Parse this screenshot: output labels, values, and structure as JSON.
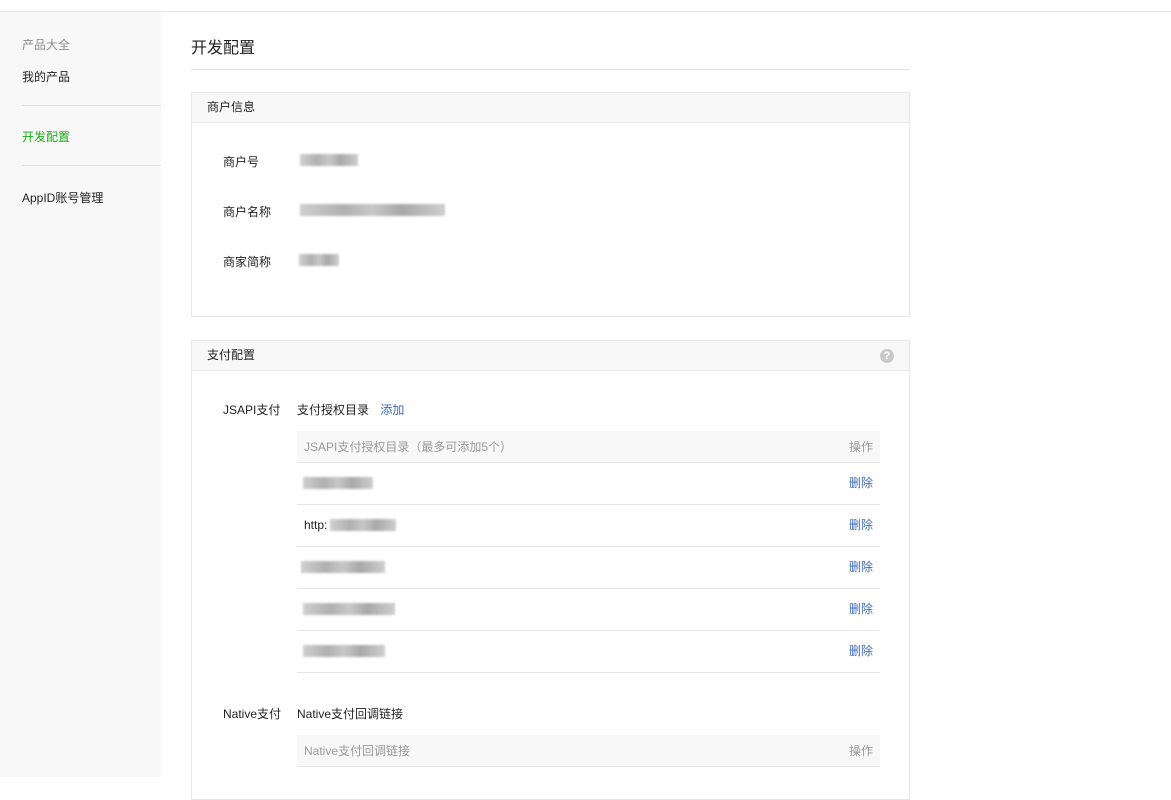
{
  "sidebar": {
    "section_title": "产品大全",
    "items": [
      {
        "label": "我的产品"
      },
      {
        "label": "开发配置"
      },
      {
        "label": "AppID账号管理"
      }
    ]
  },
  "page": {
    "title": "开发配置"
  },
  "merchant_panel": {
    "title": "商户信息",
    "fields": [
      {
        "label": "商户号"
      },
      {
        "label": "商户名称"
      },
      {
        "label": "商家简称"
      }
    ]
  },
  "pay_panel": {
    "title": "支付配置",
    "help_icon": "?",
    "jsapi": {
      "label": "JSAPI支付",
      "sub_label": "支付授权目录",
      "add_label": "添加",
      "table_header": "JSAPI支付授权目录（最多可添加5个）",
      "op_header": "操作",
      "rows": [
        {
          "prefix": "",
          "delete": "删除"
        },
        {
          "prefix": "http:",
          "delete": "删除"
        },
        {
          "prefix": "",
          "delete": "删除"
        },
        {
          "prefix": "",
          "delete": "删除"
        },
        {
          "prefix": "",
          "delete": "删除"
        }
      ]
    },
    "native": {
      "label": "Native支付",
      "sub_label": "Native支付回调链接",
      "table_header": "Native支付回调链接",
      "op_header": "操作"
    }
  },
  "colors": {
    "accent": "#1aad19",
    "link": "#3f6cb5"
  }
}
